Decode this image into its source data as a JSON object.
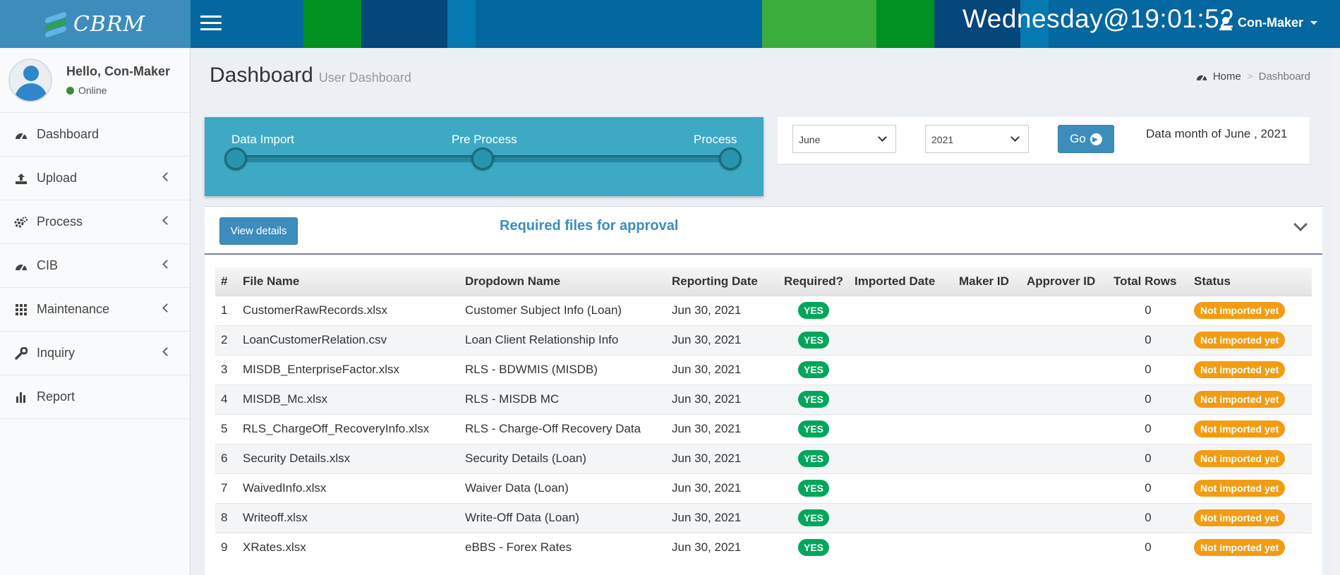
{
  "app": {
    "logo_text": "CBRM"
  },
  "header": {
    "clock": "Wednesday@19:01:52",
    "user": "Con-Maker",
    "bands": [
      "#3aad3c",
      "#019122",
      "#05467b",
      "#0579b0",
      "#05679f",
      "#3aad3c",
      "#019122",
      "#05467b",
      "#0579b0"
    ]
  },
  "sidebar": {
    "greeting": "Hello, Con-Maker",
    "status": "Online",
    "items": [
      {
        "label": "Dashboard",
        "icon": "dashboard-icon"
      },
      {
        "label": "Upload",
        "icon": "upload-icon"
      },
      {
        "label": "Process",
        "icon": "cogs-icon"
      },
      {
        "label": "CIB",
        "icon": "dashboard-icon"
      },
      {
        "label": "Maintenance",
        "icon": "grid-icon"
      },
      {
        "label": "Inquiry",
        "icon": "wrench-icon"
      },
      {
        "label": "Report",
        "icon": "bar-chart-icon"
      }
    ]
  },
  "page": {
    "title": "Dashboard",
    "subtitle": "User Dashboard",
    "breadcrumb": {
      "home": "Home",
      "current": "Dashboard",
      "separator": ">"
    }
  },
  "progress": {
    "steps": [
      "Data Import",
      "Pre Process",
      "Process"
    ]
  },
  "filter": {
    "month": "June",
    "year": "2021",
    "go_label": "Go",
    "data_month_text": "Data month of June , 2021"
  },
  "files_box": {
    "view_details_label": "View details",
    "title": "Required files for approval",
    "columns": [
      "#",
      "File Name",
      "Dropdown Name",
      "Reporting Date",
      "Required?",
      "Imported Date",
      "Maker ID",
      "Approver ID",
      "Total Rows",
      "Status"
    ],
    "rows": [
      {
        "n": "1",
        "file": "CustomerRawRecords.xlsx",
        "dropdown": "Customer Subject Info (Loan)",
        "date": "Jun 30, 2021",
        "required": "YES",
        "imported": "",
        "maker": "",
        "approver": "",
        "total": "0",
        "status": "Not imported yet"
      },
      {
        "n": "2",
        "file": "LoanCustomerRelation.csv",
        "dropdown": "Loan Client Relationship Info",
        "date": "Jun 30, 2021",
        "required": "YES",
        "imported": "",
        "maker": "",
        "approver": "",
        "total": "0",
        "status": "Not imported yet"
      },
      {
        "n": "3",
        "file": "MISDB_EnterpriseFactor.xlsx",
        "dropdown": "RLS - BDWMIS (MISDB)",
        "date": "Jun 30, 2021",
        "required": "YES",
        "imported": "",
        "maker": "",
        "approver": "",
        "total": "0",
        "status": "Not imported yet"
      },
      {
        "n": "4",
        "file": "MISDB_Mc.xlsx",
        "dropdown": "RLS - MISDB MC",
        "date": "Jun 30, 2021",
        "required": "YES",
        "imported": "",
        "maker": "",
        "approver": "",
        "total": "0",
        "status": "Not imported yet"
      },
      {
        "n": "5",
        "file": "RLS_ChargeOff_RecoveryInfo.xlsx",
        "dropdown": "RLS - Charge-Off Recovery Data",
        "date": "Jun 30, 2021",
        "required": "YES",
        "imported": "",
        "maker": "",
        "approver": "",
        "total": "0",
        "status": "Not imported yet"
      },
      {
        "n": "6",
        "file": "Security Details.xlsx",
        "dropdown": "Security Details (Loan)",
        "date": "Jun 30, 2021",
        "required": "YES",
        "imported": "",
        "maker": "",
        "approver": "",
        "total": "0",
        "status": "Not imported yet"
      },
      {
        "n": "7",
        "file": "WaivedInfo.xlsx",
        "dropdown": "Waiver Data (Loan)",
        "date": "Jun 30, 2021",
        "required": "YES",
        "imported": "",
        "maker": "",
        "approver": "",
        "total": "0",
        "status": "Not imported yet"
      },
      {
        "n": "8",
        "file": "Writeoff.xlsx",
        "dropdown": "Write-Off Data (Loan)",
        "date": "Jun 30, 2021",
        "required": "YES",
        "imported": "",
        "maker": "",
        "approver": "",
        "total": "0",
        "status": "Not imported yet"
      },
      {
        "n": "9",
        "file": "XRates.xlsx",
        "dropdown": "eBBS - Forex Rates",
        "date": "Jun 30, 2021",
        "required": "YES",
        "imported": "",
        "maker": "",
        "approver": "",
        "total": "0",
        "status": "Not imported yet"
      }
    ]
  }
}
